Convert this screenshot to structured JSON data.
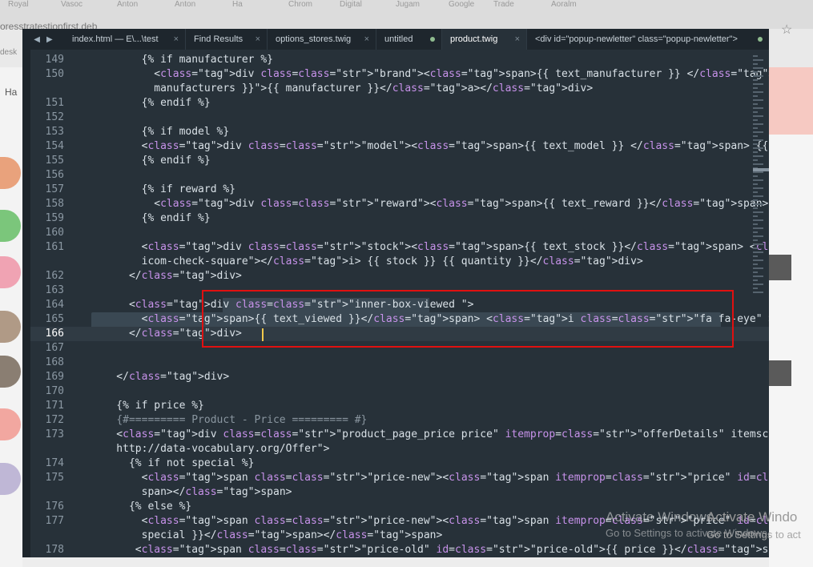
{
  "browser": {
    "bookmarks": [
      "Royal",
      "Vasoc",
      "Anton",
      "Anton",
      "Ha",
      "Chrom",
      "Digital",
      "Jugam",
      "Google",
      "Trade",
      "Aoralm"
    ],
    "url_fragment": "oresstratestionfirst.deb",
    "desk_label": "desk",
    "side_label": "Ha"
  },
  "tabs": [
    {
      "label": "index.html — E\\...\\test",
      "status": "close"
    },
    {
      "label": "Find Results",
      "status": "close"
    },
    {
      "label": "options_stores.twig",
      "status": "close"
    },
    {
      "label": "untitled",
      "status": "dirty"
    },
    {
      "label": "product.twig",
      "status": "close",
      "active": true
    },
    {
      "label": "<div id=\"popup-newletter\" class=\"popup-newletter\">",
      "status": "dirty"
    }
  ],
  "code_lines": [
    {
      "n": "149",
      "t": "        {% if manufacturer %}"
    },
    {
      "n": "150",
      "t": "          <div class=\"brand\"><span>{{ text_manufacturer }} </span><a href=\"{{"
    },
    {
      "n": "",
      "t": "          manufacturers }}\">{{ manufacturer }}</a></div>"
    },
    {
      "n": "151",
      "t": "        {% endif %}"
    },
    {
      "n": "152",
      "t": ""
    },
    {
      "n": "153",
      "t": "        {% if model %}"
    },
    {
      "n": "154",
      "t": "        <div class=\"model\"><span>{{ text_model }} </span> {{ model }}</div>"
    },
    {
      "n": "155",
      "t": "        {% endif %}"
    },
    {
      "n": "156",
      "t": ""
    },
    {
      "n": "157",
      "t": "        {% if reward %}"
    },
    {
      "n": "158",
      "t": "          <div class=\"reward\"><span>{{ text_reward }}</span> {{ reward }}</div>"
    },
    {
      "n": "159",
      "t": "        {% endif %}"
    },
    {
      "n": "160",
      "t": ""
    },
    {
      "n": "161",
      "t": "        <div class=\"stock\"><span>{{ text_stock }}</span> <i class=\""
    },
    {
      "n": "",
      "t": "        icom-check-square\"></i> {{ stock }} {{ quantity }}</div>"
    },
    {
      "n": "162",
      "t": "      </div>"
    },
    {
      "n": "163",
      "t": ""
    },
    {
      "n": "164",
      "t": "      <div class=\"inner-box-viewed \">"
    },
    {
      "n": "165",
      "t": "        <span>{{ text_viewed }}</span> <i class=\"fa fa-eye\" ></i> {{ viewed }}"
    },
    {
      "n": "166",
      "t": "      </div>",
      "current": true
    },
    {
      "n": "167",
      "t": ""
    },
    {
      "n": "168",
      "t": ""
    },
    {
      "n": "169",
      "t": "    </div>"
    },
    {
      "n": "170",
      "t": ""
    },
    {
      "n": "171",
      "t": "    {% if price %}"
    },
    {
      "n": "172",
      "t": "    {#========= Product - Price ========= #}"
    },
    {
      "n": "173",
      "t": "    <div class=\"product_page_price price\" itemprop=\"offerDetails\" itemscope itemtype=\""
    },
    {
      "n": "",
      "t": "    http://data-vocabulary.org/Offer\">"
    },
    {
      "n": "174",
      "t": "      {% if not special %}"
    },
    {
      "n": "175",
      "t": "        <span class=\"price-new\"><span itemprop=\"price\" id=\"price-old\">{{ price }}</"
    },
    {
      "n": "",
      "t": "        span></span>"
    },
    {
      "n": "176",
      "t": "      {% else %}"
    },
    {
      "n": "177",
      "t": "        <span class=\"price-new\"><span itemprop=\"price\" id=\"price-special\">{{"
    },
    {
      "n": "",
      "t": "        special }}</span></span>"
    },
    {
      "n": "178",
      "t": "       <span class=\"price-old\" id=\"price-old\">{{ price }}</span>"
    }
  ],
  "watermark": {
    "line1": "Activate Windows",
    "line2": "Go to Settings to activate Windows.",
    "outer1": "Activate Windo",
    "outer2": "Go to Settings to act"
  },
  "colors": {
    "editor_bg": "#273139",
    "tag": "#e66a6a",
    "string": "#c3e88d",
    "highlight_box": "#e01010",
    "caret": "#f2c94c"
  }
}
